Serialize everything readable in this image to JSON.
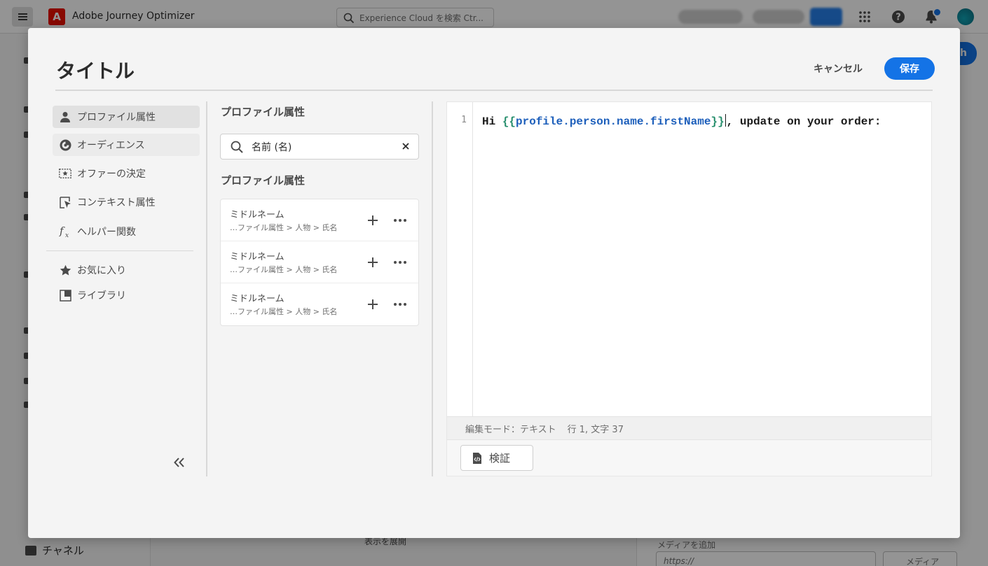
{
  "app": {
    "name": "Adobe Journey Optimizer",
    "search_placeholder": "Experience Cloud を検索  Ctr..."
  },
  "background": {
    "channel_label": "チャネル",
    "expand_label": "表示を展開",
    "media_label": "メディアを追加",
    "media_placeholder": "https://",
    "media_button": "メディアを..."
  },
  "dialog": {
    "title": "タイトル",
    "cancel_label": "キャンセル",
    "save_label": "保存"
  },
  "categories": {
    "items": [
      {
        "label": "プロファイル属性",
        "icon": "person-icon",
        "state": "selected"
      },
      {
        "label": "オーディエンス",
        "icon": "audience-icon",
        "state": "hovered"
      },
      {
        "label": "オファーの決定",
        "icon": "offer-icon",
        "state": "normal"
      },
      {
        "label": "コンテキスト属性",
        "icon": "context-icon",
        "state": "normal"
      },
      {
        "label": "ヘルパー関数",
        "icon": "function-icon",
        "state": "normal"
      }
    ],
    "extras": [
      {
        "label": "お気に入り",
        "icon": "star-icon"
      },
      {
        "label": "ライブラリ",
        "icon": "library-icon"
      }
    ]
  },
  "attributes": {
    "heading": "プロファイル属性",
    "search_value": "名前 (名)",
    "results_heading": "プロファイル属性",
    "rows": [
      {
        "name": "ミドルネーム",
        "path": "…ファイル属性 > 人物 > 氏名"
      },
      {
        "name": "ミドルネーム",
        "path": "…ファイル属性 > 人物 > 氏名"
      },
      {
        "name": "ミドルネーム",
        "path": "…ファイル属性 > 人物 > 氏名"
      }
    ]
  },
  "editor": {
    "line_number": "1",
    "code": {
      "prefix": "Hi ",
      "open": "{{",
      "variable": "profile.person.name.firstName",
      "close": "}}",
      "suffix": ", update on your order:"
    },
    "status_mode": "編集モード：テキスト",
    "status_position": "行 1, 文字 37",
    "validate_label": "検証"
  },
  "colors": {
    "accent": "#1473e6",
    "code_brace": "#268e6c",
    "code_variable": "#1d5fbb"
  }
}
